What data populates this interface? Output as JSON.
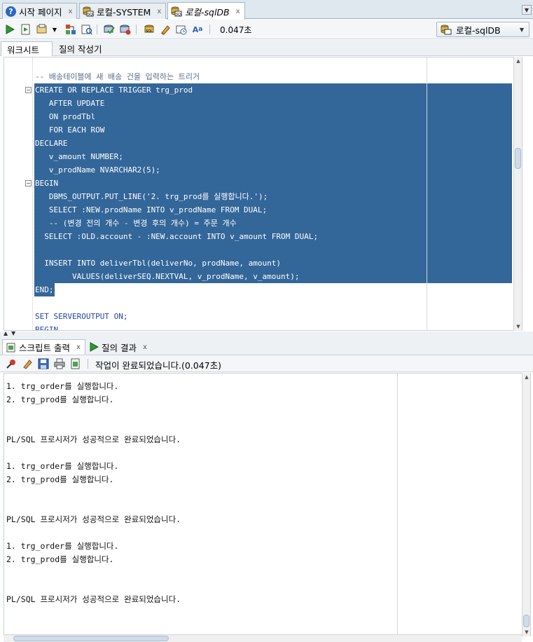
{
  "tabs": [
    {
      "label": "시작 페이지",
      "icon": "help-icon"
    },
    {
      "label": "로컬-SYSTEM",
      "icon": "sql-worksheet-icon"
    },
    {
      "label": "로컬-sqlDB",
      "icon": "sql-worksheet-icon",
      "active": true
    }
  ],
  "toolbar": {
    "elapsed": "0.047초",
    "connection": "로컬-sqlDB",
    "icons": [
      "run-statement-icon",
      "run-script-icon",
      "commit-icon",
      "explain-plan-icon",
      "autotrace-icon",
      "rollback-icon",
      "sql-tuning-icon",
      "unshared-sql-icon",
      "clear-icon",
      "history-icon",
      "format-icon"
    ]
  },
  "subtabs": {
    "worksheet": "워크시트",
    "query_builder": "질의 작성기"
  },
  "editor": {
    "lines": [
      {
        "text": "-- 배송테이블에 새 배송 건을 입력하는 트리거",
        "type": "comment",
        "selected": false
      },
      {
        "text": "CREATE OR REPLACE TRIGGER trg_prod",
        "type": "code",
        "selected": true,
        "fold": true
      },
      {
        "text": "   AFTER UPDATE",
        "type": "code",
        "selected": true
      },
      {
        "text": "   ON prodTbl",
        "type": "code",
        "selected": true
      },
      {
        "text": "   FOR EACH ROW",
        "type": "code",
        "selected": true
      },
      {
        "text": "DECLARE",
        "type": "code",
        "selected": true
      },
      {
        "text": "   v_amount NUMBER;",
        "type": "code",
        "selected": true
      },
      {
        "text": "   v_prodName NVARCHAR2(5);",
        "type": "code",
        "selected": true
      },
      {
        "text": "BEGIN",
        "type": "code",
        "selected": true,
        "fold": true
      },
      {
        "text": "   DBMS_OUTPUT.PUT_LINE('2. trg_prod를 실행합니다.');",
        "type": "code",
        "selected": true
      },
      {
        "text": "   SELECT :NEW.prodName INTO v_prodName FROM DUAL;",
        "type": "code",
        "selected": true
      },
      {
        "text": "   -- (변경 전의 개수 - 변경 후의 개수) = 주문 개수",
        "type": "code",
        "selected": true
      },
      {
        "text": "  SELECT :OLD.account - :NEW.account INTO v_amount FROM DUAL;",
        "type": "code",
        "selected": true
      },
      {
        "text": "",
        "type": "code",
        "selected": true
      },
      {
        "text": "  INSERT INTO deliverTbl(deliverNo, prodName, amount)",
        "type": "code",
        "selected": true
      },
      {
        "text": "        VALUES(deliverSEQ.NEXTVAL, v_prodName, v_amount);",
        "type": "code",
        "selected": true
      },
      {
        "text": "END;",
        "type": "code",
        "selected": true,
        "partial": true
      },
      {
        "text": "",
        "type": "code",
        "selected": false
      },
      {
        "text": "SET SERVEROUTPUT ON;",
        "type": "code",
        "selected": false
      },
      {
        "text": "BEGIN",
        "type": "code",
        "selected": false
      }
    ]
  },
  "output_tabs": {
    "script_output": "스크립트 출력",
    "query_result": "질의 결과"
  },
  "output_status": "작업이 완료되었습니다.(0.047초)",
  "output_lines": [
    "1. trg_order를 실행합니다.",
    "2. trg_prod를 실행합니다.",
    "",
    "",
    "PL/SQL 프로시저가 성공적으로 완료되었습니다.",
    "",
    "1. trg_order를 실행합니다.",
    "2. trg_prod를 실행합니다.",
    "",
    "",
    "PL/SQL 프로시저가 성공적으로 완료되었습니다.",
    "",
    "1. trg_order를 실행합니다.",
    "2. trg_prod를 실행합니다.",
    "",
    "",
    "PL/SQL 프로시저가 성공적으로 완료되었습니다."
  ],
  "close_glyph": "x"
}
